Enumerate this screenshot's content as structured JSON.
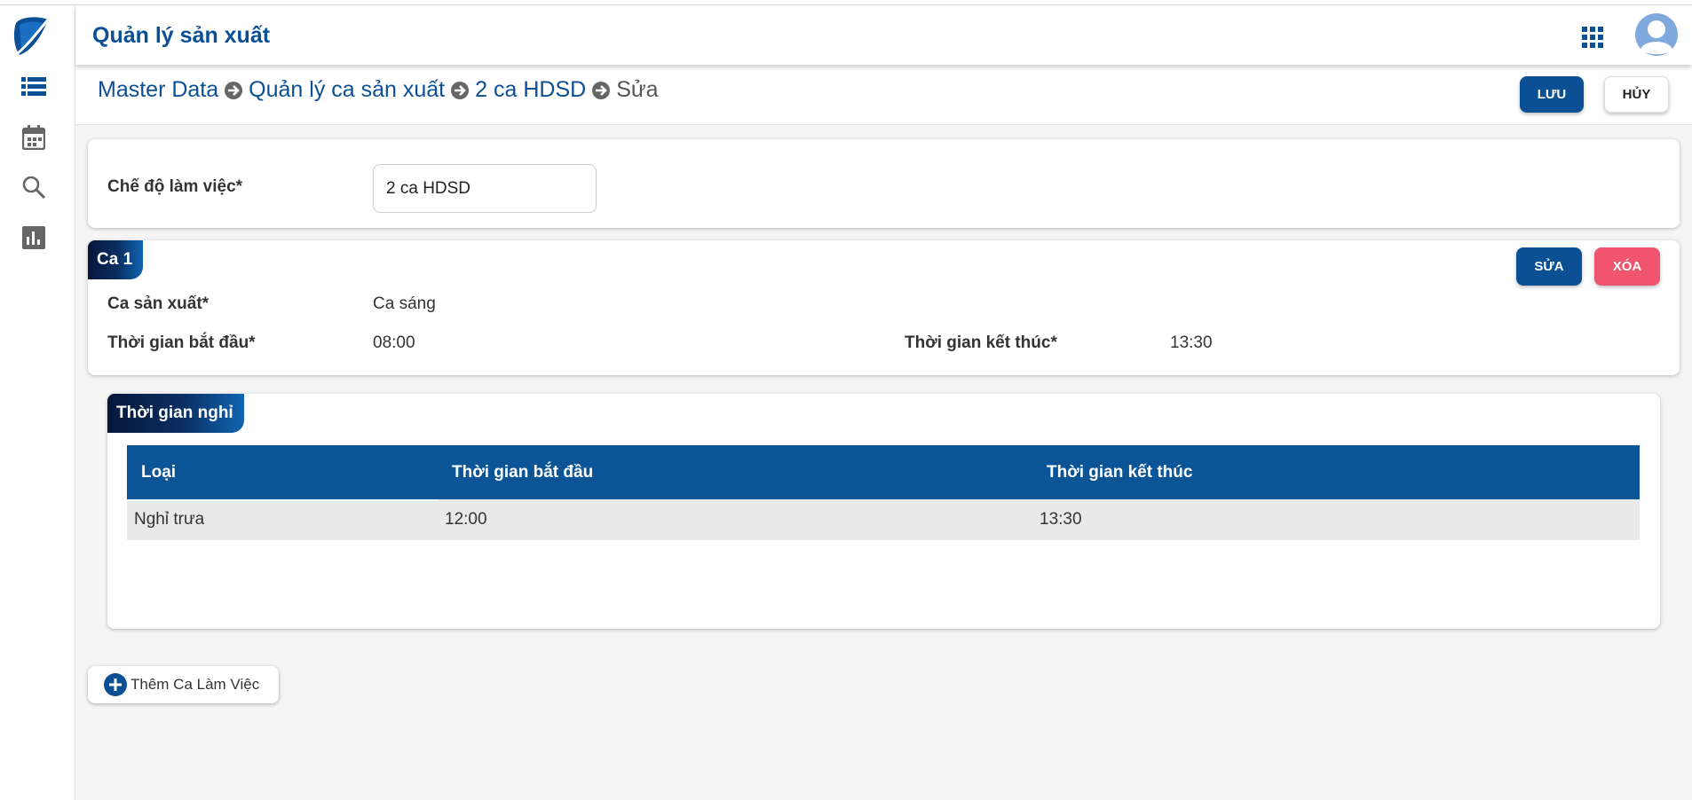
{
  "header": {
    "title": "Quản lý sản xuất",
    "apps_icon": "grid-apps-icon",
    "avatar_icon": "user-avatar-icon"
  },
  "sidebar": {
    "logo": "brand-logo",
    "items": [
      {
        "icon": "list-icon"
      },
      {
        "icon": "calendar-icon"
      },
      {
        "icon": "search-icon"
      },
      {
        "icon": "bar-chart-icon"
      }
    ]
  },
  "breadcrumb": {
    "items": [
      "Master Data",
      "Quản lý ca sản xuất",
      "2 ca HDSD",
      "Sửa"
    ],
    "separator_icon": "arrow-circle-right-icon"
  },
  "actions": {
    "save": "LƯU",
    "cancel": "HỦY"
  },
  "work_mode": {
    "label": "Chế độ làm việc*",
    "value": "2 ca HDSD"
  },
  "shift": {
    "tag": "Ca 1",
    "edit": "SỬA",
    "delete": "XÓA",
    "production_shift_label": "Ca sản xuất*",
    "production_shift_value": "Ca sáng",
    "start_label": "Thời gian bắt đầu*",
    "start_value": "08:00",
    "end_label": "Thời gian kết thúc*",
    "end_value": "13:30"
  },
  "breaks": {
    "tag": "Thời gian nghỉ",
    "columns": [
      "Loại",
      "Thời gian bắt đầu",
      "Thời gian kết thúc"
    ],
    "rows": [
      [
        "Nghỉ trưa",
        "12:00",
        "13:30"
      ]
    ]
  },
  "add_shift": {
    "label": "Thêm Ca Làm Việc"
  },
  "colors": {
    "primary": "#0b4f94",
    "danger": "#f0546f",
    "table_header": "#0b5596",
    "background": "#f5f5f5"
  }
}
